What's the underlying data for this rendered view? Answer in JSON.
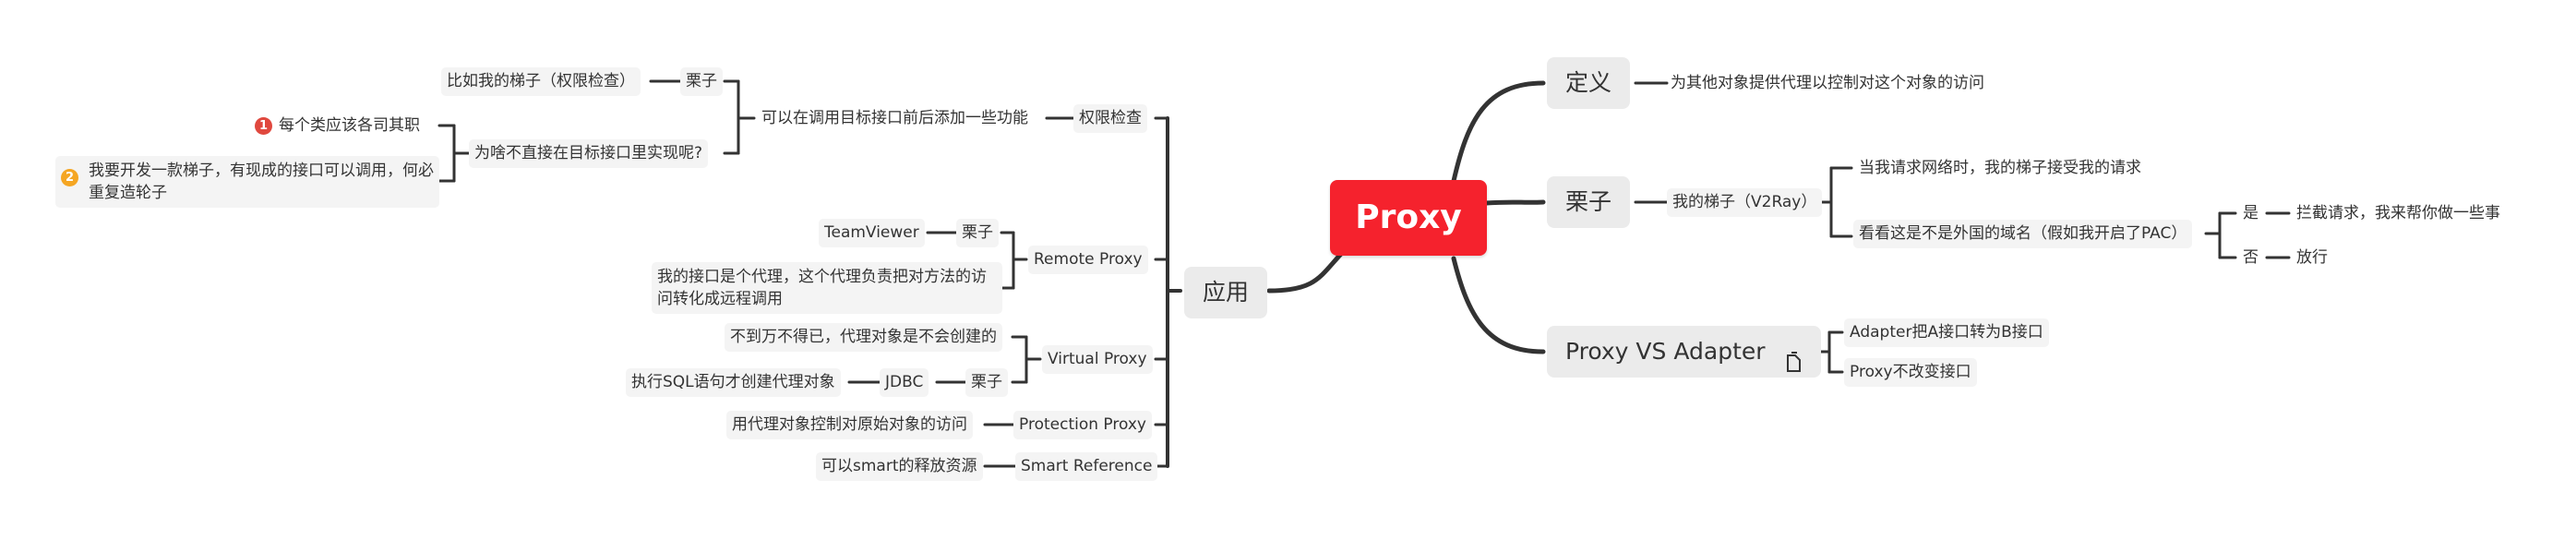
{
  "root": {
    "label": "Proxy",
    "color": "#f5222d"
  },
  "right": {
    "definition": {
      "label": "定义",
      "children": [
        "为其他对象提供代理以控制对这个对象的访问"
      ]
    },
    "example": {
      "label": "栗子",
      "child": "我的梯子（V2Ray）",
      "children": [
        {
          "label": "当我请求网络时，我的梯子接受我的请求"
        },
        {
          "label": "看看这是不是外国的域名（假如我开启了PAC）",
          "branches": [
            {
              "label": "是",
              "child": "拦截请求，我来帮你做一些事"
            },
            {
              "label": "否",
              "child": "放行"
            }
          ]
        }
      ]
    },
    "vs": {
      "label": "Proxy VS Adapter",
      "icon": "note-icon",
      "children": [
        "Adapter把A接口转为B接口",
        "Proxy不改变接口"
      ]
    }
  },
  "left": {
    "label": "应用",
    "branches": [
      {
        "label": "权限检查",
        "child": "可以在调用目标接口前后添加一些功能",
        "children": [
          {
            "label": "栗子",
            "child": "比如我的梯子（权限检查）"
          },
          {
            "label": "为啥不直接在目标接口里实现呢?",
            "reasons": [
              {
                "badge": "1",
                "color": "#e0483e",
                "text": "每个类应该各司其职"
              },
              {
                "badge": "2",
                "color": "#f5a623",
                "text": "我要开发一款梯子，有现成的接口可以调用，何必重复造轮子"
              }
            ]
          }
        ]
      },
      {
        "label": "Remote Proxy",
        "children": [
          {
            "label": "栗子",
            "child": "TeamViewer"
          },
          {
            "label": "我的接口是个代理，这个代理负责把对方法的访问转化成远程调用"
          }
        ]
      },
      {
        "label": "Virtual Proxy",
        "children": [
          {
            "label": "不到万不得已，代理对象是不会创建的"
          },
          {
            "label": "栗子",
            "child": "JDBC",
            "grandchild": "执行SQL语句才创建代理对象"
          }
        ]
      },
      {
        "label": "Protection Proxy",
        "child": "用代理对象控制对原始对象的访问"
      },
      {
        "label": "Smart Reference",
        "child": "可以smart的释放资源"
      }
    ]
  }
}
